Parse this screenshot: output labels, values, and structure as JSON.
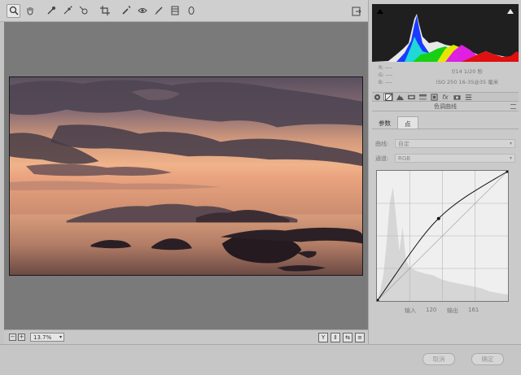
{
  "toolbar": {
    "tools": [
      "zoom-icon",
      "hand-icon",
      "eyedropper-icon",
      "color-sampler-icon",
      "target-adjust-icon",
      "crop-icon",
      "spot-removal-icon",
      "red-eye-icon",
      "adjustment-brush-icon",
      "graduated-filter-icon",
      "radial-filter-icon"
    ]
  },
  "statusbar": {
    "zoom_minus": "−",
    "zoom_plus": "+",
    "zoom_value": "13.7%",
    "view_buttons": [
      "Y",
      "⇕",
      "⇆",
      "≡"
    ]
  },
  "info": {
    "r_label": "R:",
    "r_value": "----",
    "g_label": "G:",
    "g_value": "----",
    "b_label": "B:",
    "b_value": "----",
    "exposure": "f/14   1/20 秒",
    "iso_lens": "ISO 250   16-35@35 毫米"
  },
  "panel": {
    "section_title": "色调曲线",
    "subtabs": [
      "参数",
      "点"
    ],
    "curve_label": "曲线:",
    "curve_value": "自定",
    "channel_label": "通道:",
    "channel_value": "RGB",
    "input_label": "输入",
    "input_value": "120",
    "output_label": "输出",
    "output_value": "161"
  },
  "buttons": {
    "cancel": "取消",
    "ok": "确定"
  },
  "colors": {
    "canvas_bg": "#7a7a7a",
    "panel_bg": "#cacaca",
    "histogram_bg": "#1f1f1f",
    "clip_red": "#e01010"
  }
}
